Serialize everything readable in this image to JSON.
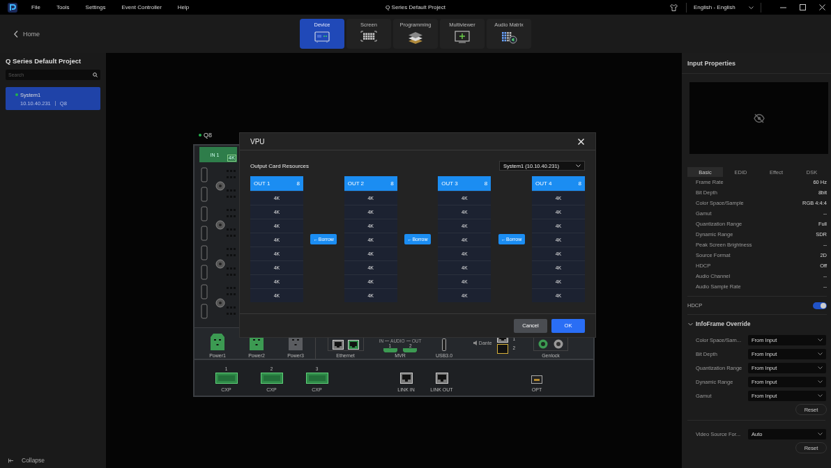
{
  "title_bar": {
    "menu": [
      "File",
      "Tools",
      "Settings",
      "Event Controller",
      "Help"
    ],
    "title": "Q Series Default Project",
    "language": "English - English"
  },
  "toolbar": {
    "back": "Home",
    "tabs": [
      {
        "label": "Device",
        "kind": "device",
        "selected": true
      },
      {
        "label": "Screen",
        "kind": "screen",
        "selected": false
      },
      {
        "label": "Programming",
        "kind": "layers",
        "selected": false
      },
      {
        "label": "Multiviewer",
        "kind": "multiviewer",
        "selected": false
      },
      {
        "label": "Audio Matrix",
        "kind": "audio",
        "selected": false
      }
    ]
  },
  "sidebar": {
    "title": "Q Series Default Project",
    "search": {
      "placeholder": "Search"
    },
    "systems": [
      {
        "name": "System1",
        "ip": "10.10.40.231",
        "model": "Q8",
        "online": true,
        "selected": true
      }
    ],
    "collapse": "Collapse"
  },
  "device": {
    "name": "Q8",
    "online": true,
    "input": {
      "label": "IN 1",
      "badge": "4K"
    },
    "rear_ports": [
      {
        "kind": "power",
        "label": "Power1",
        "active": true
      },
      {
        "kind": "power",
        "label": "Power2",
        "active": true
      },
      {
        "kind": "power",
        "label": "Power3",
        "active": false
      },
      {
        "kind": "ethernet",
        "label": "Ethernet"
      },
      {
        "kind": "mvr",
        "label": "MVR",
        "audio": [
          "IN",
          "AUDIO",
          "OUT"
        ],
        "numbers": [
          "1",
          "2"
        ]
      },
      {
        "kind": "usb",
        "label": "USB3.0"
      },
      {
        "kind": "dante",
        "label": "Dante",
        "numbers": [
          "1",
          "2"
        ]
      },
      {
        "kind": "genlock",
        "label": "Genlock"
      }
    ],
    "links": [
      {
        "kind": "cxp",
        "number": "1",
        "label": "CXP"
      },
      {
        "kind": "cxp",
        "number": "2",
        "label": "CXP"
      },
      {
        "kind": "cxp",
        "number": "3",
        "label": "CXP"
      },
      {
        "kind": "link",
        "label": "LINK IN"
      },
      {
        "kind": "link",
        "label": "LINK OUT"
      },
      {
        "kind": "opt",
        "label": "OPT"
      }
    ]
  },
  "dialog": {
    "title": "VPU",
    "section": "Output Card Resources",
    "system_select": "System1 (10.10.40.231)",
    "outputs": [
      {
        "name": "OUT 1",
        "count": "8",
        "slots": [
          "4K",
          "4K",
          "4K",
          "4K",
          "4K",
          "4K",
          "4K",
          "4K"
        ]
      },
      {
        "name": "OUT 2",
        "count": "8",
        "slots": [
          "4K",
          "4K",
          "4K",
          "4K",
          "4K",
          "4K",
          "4K",
          "4K"
        ]
      },
      {
        "name": "OUT 3",
        "count": "8",
        "slots": [
          "4K",
          "4K",
          "4K",
          "4K",
          "4K",
          "4K",
          "4K",
          "4K"
        ]
      },
      {
        "name": "OUT 4",
        "count": "8",
        "slots": [
          "4K",
          "4K",
          "4K",
          "4K",
          "4K",
          "4K",
          "4K",
          "4K"
        ]
      }
    ],
    "borrow": [
      "←Borrow",
      "←Borrow",
      "←Borrow"
    ],
    "buttons": [
      {
        "label": "Cancel",
        "kind": "secondary"
      },
      {
        "label": "OK",
        "kind": "primary"
      }
    ]
  },
  "input_properties": {
    "title": "Input Properties",
    "tabs": [
      {
        "label": "Basic",
        "selected": true
      },
      {
        "label": "EDID",
        "selected": false
      },
      {
        "label": "Effect",
        "selected": false
      },
      {
        "label": "DSK",
        "selected": false
      }
    ],
    "properties": [
      {
        "label": "Frame Rate",
        "value": "60 Hz"
      },
      {
        "label": "Bit Depth",
        "value": "8bit"
      },
      {
        "label": "Color Space/Sample",
        "value": "RGB 4:4:4"
      },
      {
        "label": "Gamut",
        "value": "--"
      },
      {
        "label": "Quantization Range",
        "value": "Full"
      },
      {
        "label": "Dynamic Range",
        "value": "SDR"
      },
      {
        "label": "Peak Screen Brightness",
        "value": "--"
      },
      {
        "label": "Source Format",
        "value": "2D"
      },
      {
        "label": "HDCP",
        "value": "Off"
      },
      {
        "label": "Audio Channel",
        "value": "--"
      },
      {
        "label": "Audio Sample Rate",
        "value": "--"
      }
    ],
    "hdcp": {
      "label": "HDCP",
      "on": true
    },
    "override": {
      "title": "InfoFrame Override",
      "expanded": true,
      "fields": [
        {
          "label": "Color Space/Sam...",
          "value": "From Input"
        },
        {
          "label": "Bit Depth",
          "value": "From Input"
        },
        {
          "label": "Quantization Range",
          "value": "From Input"
        },
        {
          "label": "Dynamic Range",
          "value": "From Input"
        },
        {
          "label": "Gamut",
          "value": "From Input"
        }
      ],
      "reset": "Reset"
    },
    "video_source": {
      "label": "Video Source For...",
      "value": "Auto"
    },
    "reset": "Reset"
  }
}
